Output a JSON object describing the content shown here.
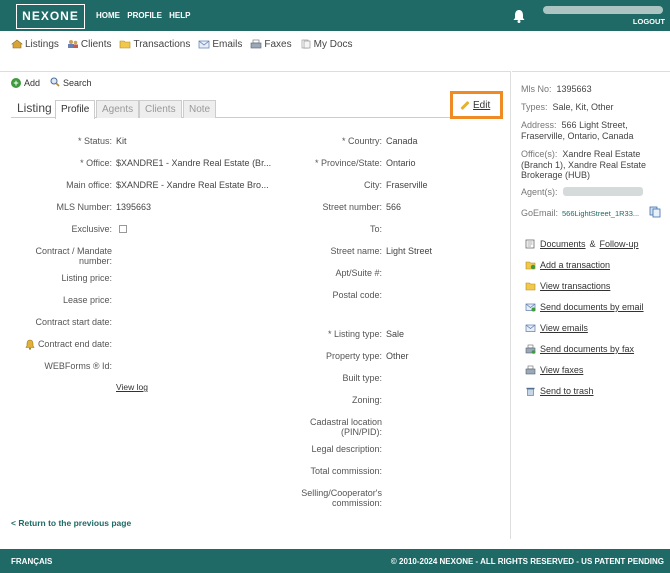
{
  "header": {
    "logo": "NEXONE",
    "nav": [
      "HOME",
      "PROFILE",
      "HELP"
    ],
    "logout": "LOGOUT"
  },
  "mainnav": [
    {
      "label": "Listings",
      "icon": "house-icon"
    },
    {
      "label": "Clients",
      "icon": "clients-icon"
    },
    {
      "label": "Transactions",
      "icon": "folder-icon"
    },
    {
      "label": "Emails",
      "icon": "email-icon"
    },
    {
      "label": "Faxes",
      "icon": "fax-icon"
    },
    {
      "label": "My Docs",
      "icon": "docs-icon"
    }
  ],
  "actions": {
    "add": "Add",
    "search": "Search"
  },
  "tabs": {
    "title": "Listing",
    "items": [
      "Profile",
      "Agents",
      "Clients",
      "Note"
    ],
    "active": "Profile"
  },
  "edit_label": "Edit",
  "left_fields": [
    {
      "label": "* Status:",
      "value": "Kit"
    },
    {
      "label": "* Office:",
      "value": "$XANDRE1 - Xandre Real Estate (Br..."
    },
    {
      "label": "Main office:",
      "value": "$XANDRE - Xandre Real Estate Bro..."
    },
    {
      "label": "MLS Number:",
      "value": "1395663"
    },
    {
      "label": "Exclusive:",
      "value": ""
    },
    {
      "label": "Contract / Mandate number:",
      "value": ""
    },
    {
      "label": "Listing price:",
      "value": ""
    },
    {
      "label": "Lease price:",
      "value": ""
    },
    {
      "label": "Contract start date:",
      "value": ""
    },
    {
      "label": "Contract end date:",
      "value": ""
    },
    {
      "label": "WEBForms ® Id:",
      "value": ""
    }
  ],
  "right_fields": [
    {
      "label": "* Country:",
      "value": "Canada"
    },
    {
      "label": "* Province/State:",
      "value": "Ontario"
    },
    {
      "label": "City:",
      "value": "Fraserville"
    },
    {
      "label": "Street number:",
      "value": "566"
    },
    {
      "label": "To:",
      "value": ""
    },
    {
      "label": "Street name:",
      "value": "Light Street"
    },
    {
      "label": "Apt/Suite #:",
      "value": ""
    },
    {
      "label": "Postal code:",
      "value": ""
    },
    {
      "label": "* Listing type:",
      "value": "Sale"
    },
    {
      "label": "Property type:",
      "value": "Other"
    },
    {
      "label": "Built type:",
      "value": ""
    },
    {
      "label": "Zoning:",
      "value": ""
    },
    {
      "label": "Cadastral location (PIN/PID):",
      "value": ""
    },
    {
      "label": "Legal description:",
      "value": ""
    },
    {
      "label": "Total commission:",
      "value": ""
    },
    {
      "label": "Selling/Cooperator's commission:",
      "value": ""
    }
  ],
  "view_log": "View log",
  "back_link": "< Return to the previous page",
  "sidebar": {
    "mls_label": "Mls No:",
    "mls_value": "1395663",
    "types_label": "Types:",
    "types_value": "Sale, Kit, Other",
    "address_label": "Address:",
    "address_value": "566 Light Street, Fraserville, Ontario, Canada",
    "offices_label": "Office(s):",
    "offices_value": "Xandre Real Estate (Branch 1), Xandre Real Estate Brokerage (HUB)",
    "agents_label": "Agent(s):",
    "goemail_label": "GoEmail:",
    "goemail_value": "566LightStreet_1R33...",
    "actions": [
      {
        "label": "Documents",
        "extra": " & ",
        "label2": "Follow-up",
        "icon": "documents-icon"
      },
      {
        "label": "Add a transaction",
        "icon": "add-transaction-icon"
      },
      {
        "label": "View transactions",
        "icon": "folder-icon"
      },
      {
        "label": "Send documents by email",
        "icon": "send-email-icon"
      },
      {
        "label": "View emails",
        "icon": "email-icon"
      },
      {
        "label": "Send documents by fax",
        "icon": "fax-icon"
      },
      {
        "label": "View faxes",
        "icon": "view-fax-icon"
      },
      {
        "label": "Send to trash",
        "icon": "trash-icon"
      }
    ]
  },
  "footer": {
    "left": "FRANÇAIS",
    "right": "© 2010-2024 NEXONE - ALL RIGHTS RESERVED - US PATENT PENDING"
  },
  "colors": {
    "brand": "#1f6a66",
    "highlight": "#f08a24"
  }
}
